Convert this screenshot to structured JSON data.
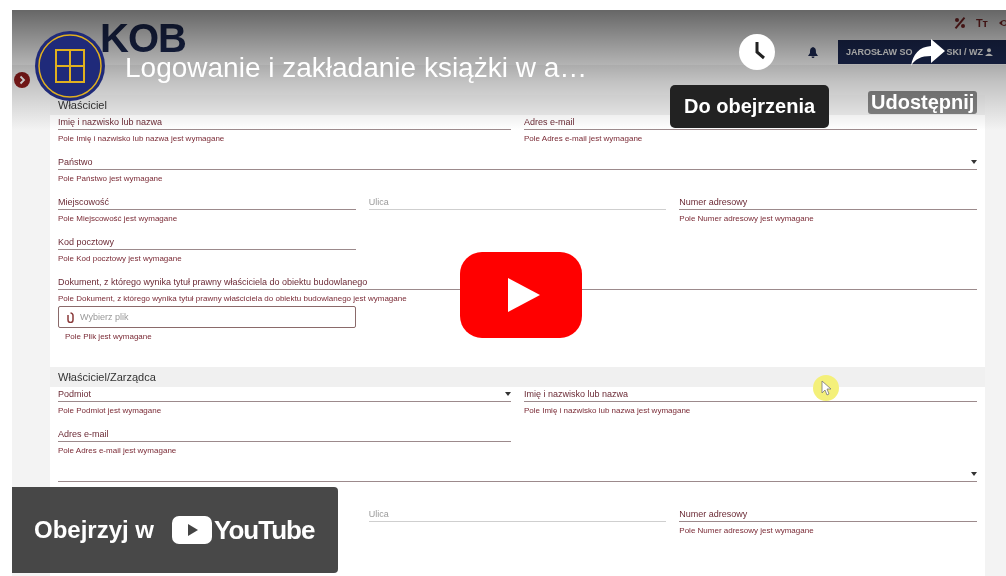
{
  "app": {
    "logo": "KOB",
    "text_size_glyph": "Tт",
    "user": {
      "name_start": "JAROSŁAW SO",
      "name_end": "SKI / WZ"
    },
    "sections": [
      {
        "title": "Właściciel",
        "rows": [
          {
            "kind": "halves",
            "fields": [
              {
                "kind": "text",
                "label": "Imię i nazwisko lub nazwa",
                "required": true,
                "error": "Pole Imię i nazwisko lub nazwa jest wymagane"
              },
              {
                "kind": "text",
                "label": "Adres e-mail",
                "required": true,
                "error": "Pole Adres e-mail jest wymagane"
              }
            ]
          },
          {
            "kind": "full",
            "fields": [
              {
                "kind": "select",
                "label": "Państwo",
                "required": true,
                "error": "Pole Państwo jest wymagane"
              }
            ]
          },
          {
            "kind": "thirds",
            "fields": [
              {
                "kind": "text",
                "label": "Miejscowość",
                "required": true,
                "error": "Pole Miejscowość jest wymagane"
              },
              {
                "kind": "text",
                "label": "Ulica",
                "required": false
              },
              {
                "kind": "text",
                "label": "Numer adresowy",
                "required": true,
                "error": "Pole Numer adresowy jest wymagane"
              }
            ]
          },
          {
            "kind": "thirds",
            "fields": [
              {
                "kind": "text",
                "label": "Kod pocztowy",
                "required": true,
                "error": "Pole Kod pocztowy jest wymagane"
              }
            ]
          },
          {
            "kind": "full",
            "fields": [
              {
                "kind": "text",
                "label": "Dokument, z którego wynika tytuł prawny właściciela do obiektu budowlanego",
                "required": true,
                "error": "Pole Dokument, z którego wynika tytuł prawny właściciela do obiektu budowlanego jest wymagane"
              }
            ]
          },
          {
            "kind": "thirds",
            "fields": [
              {
                "kind": "file",
                "placeholder": "Wybierz plik",
                "required": true,
                "error": "Pole Plik jest wymagane"
              }
            ]
          }
        ]
      },
      {
        "title": "Właściciel/Zarządca",
        "rows": [
          {
            "kind": "halves",
            "fields": [
              {
                "kind": "select",
                "label": "Podmiot",
                "required": true,
                "error": "Pole Podmiot jest wymagane"
              },
              {
                "kind": "text",
                "label": "Imię i nazwisko lub nazwa",
                "required": true,
                "error": "Pole Imię i nazwisko lub nazwa jest wymagane"
              }
            ]
          },
          {
            "kind": "halves",
            "fields": [
              {
                "kind": "text",
                "label": "Adres e-mail",
                "required": true,
                "error": "Pole Adres e-mail jest wymagane"
              }
            ]
          },
          {
            "kind": "full",
            "fields": [
              {
                "kind": "select",
                "required": true
              }
            ]
          },
          {
            "kind": "thirds_right",
            "fields": [
              {
                "kind": "text",
                "label": "Ulica",
                "required": false
              },
              {
                "kind": "text",
                "label": "Numer adresowy",
                "required": true,
                "error": "Pole Numer adresowy jest wymagane"
              }
            ]
          }
        ]
      }
    ]
  },
  "player": {
    "title": "Logowanie i zakładanie książki w a…",
    "watch_later": "Do obejrzenia",
    "share": "Udostępnij",
    "watch_on": "Obejrzyj w",
    "brand": "YouTube"
  }
}
